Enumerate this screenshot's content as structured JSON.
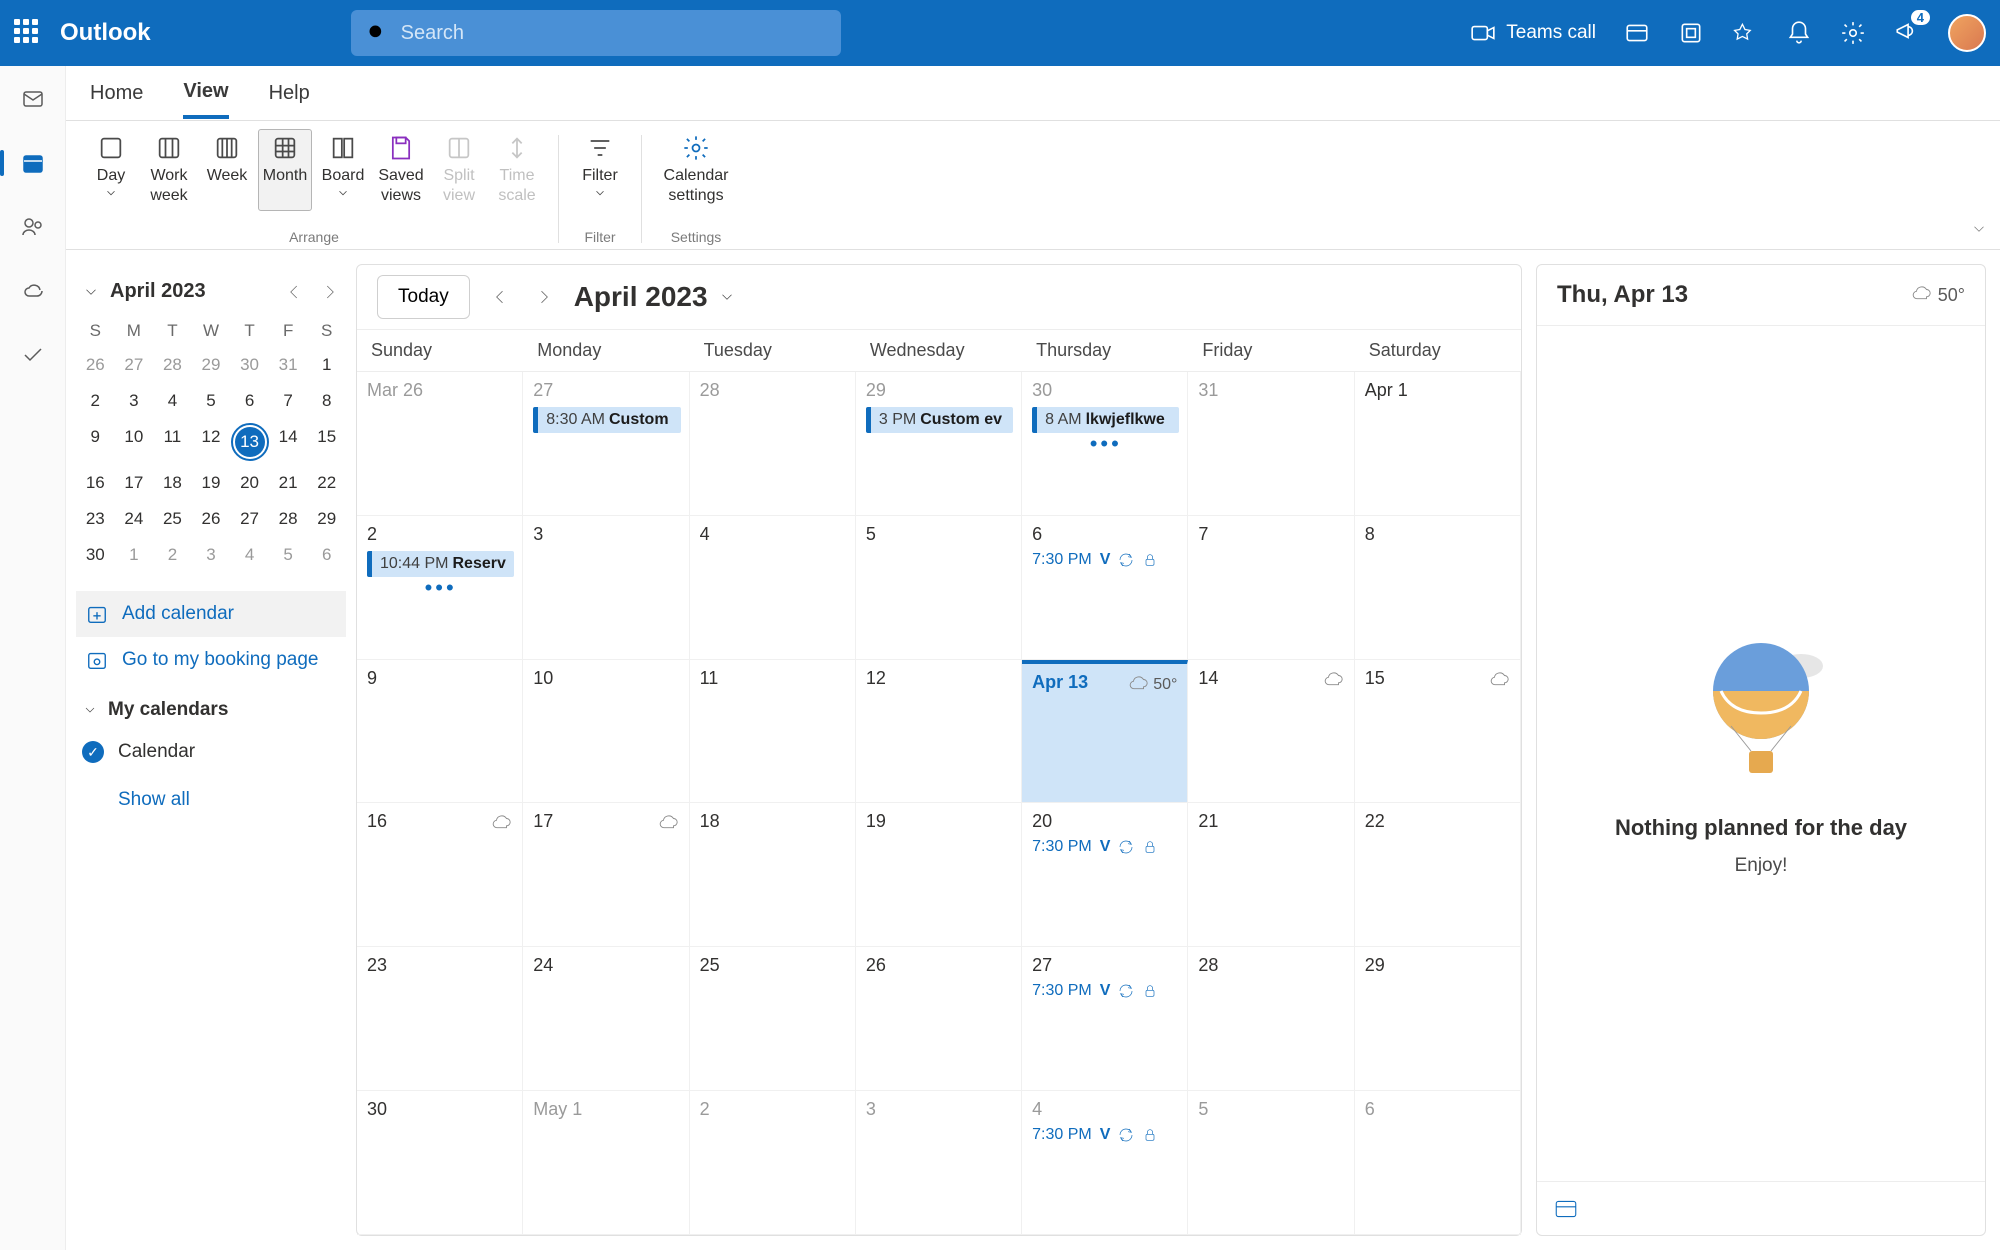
{
  "header": {
    "app_title": "Outlook",
    "search_placeholder": "Search",
    "teams_call": "Teams call",
    "notif_count": "4"
  },
  "tabs": {
    "home": "Home",
    "view": "View",
    "help": "Help",
    "active": "View"
  },
  "ribbon": {
    "day": "Day",
    "work_week": "Work week",
    "week": "Week",
    "month": "Month",
    "board": "Board",
    "saved_views": "Saved views",
    "split_view": "Split view",
    "time_scale": "Time scale",
    "filter": "Filter",
    "calendar_settings": "Calendar settings",
    "group_arrange": "Arrange",
    "group_filter": "Filter",
    "group_settings": "Settings"
  },
  "mini_cal": {
    "title": "April 2023",
    "dow": [
      "S",
      "M",
      "T",
      "W",
      "T",
      "F",
      "S"
    ],
    "days": [
      {
        "n": "26",
        "dim": true
      },
      {
        "n": "27",
        "dim": true
      },
      {
        "n": "28",
        "dim": true
      },
      {
        "n": "29",
        "dim": true
      },
      {
        "n": "30",
        "dim": true
      },
      {
        "n": "31",
        "dim": true
      },
      {
        "n": "1"
      },
      {
        "n": "2"
      },
      {
        "n": "3"
      },
      {
        "n": "4"
      },
      {
        "n": "5"
      },
      {
        "n": "6"
      },
      {
        "n": "7"
      },
      {
        "n": "8"
      },
      {
        "n": "9"
      },
      {
        "n": "10"
      },
      {
        "n": "11"
      },
      {
        "n": "12"
      },
      {
        "n": "13",
        "today": true
      },
      {
        "n": "14"
      },
      {
        "n": "15"
      },
      {
        "n": "16"
      },
      {
        "n": "17"
      },
      {
        "n": "18"
      },
      {
        "n": "19"
      },
      {
        "n": "20"
      },
      {
        "n": "21"
      },
      {
        "n": "22"
      },
      {
        "n": "23"
      },
      {
        "n": "24"
      },
      {
        "n": "25"
      },
      {
        "n": "26"
      },
      {
        "n": "27"
      },
      {
        "n": "28"
      },
      {
        "n": "29"
      },
      {
        "n": "30"
      },
      {
        "n": "1",
        "dim": true
      },
      {
        "n": "2",
        "dim": true
      },
      {
        "n": "3",
        "dim": true
      },
      {
        "n": "4",
        "dim": true
      },
      {
        "n": "5",
        "dim": true
      },
      {
        "n": "6",
        "dim": true
      }
    ]
  },
  "sidebar": {
    "add_calendar": "Add calendar",
    "booking_page": "Go to my booking page",
    "my_calendars": "My calendars",
    "calendar_item": "Calendar",
    "show_all": "Show all"
  },
  "calendar": {
    "today_btn": "Today",
    "month_title": "April 2023",
    "dow": [
      "Sunday",
      "Monday",
      "Tuesday",
      "Wednesday",
      "Thursday",
      "Friday",
      "Saturday"
    ],
    "cells": [
      {
        "date": "Mar 26",
        "dim": true
      },
      {
        "date": "27",
        "dim": true,
        "events": [
          {
            "time": "8:30 AM",
            "title": "Custom"
          }
        ]
      },
      {
        "date": "28",
        "dim": true
      },
      {
        "date": "29",
        "dim": true,
        "events": [
          {
            "time": "3 PM",
            "title": "Custom ev"
          }
        ]
      },
      {
        "date": "30",
        "dim": true,
        "events": [
          {
            "time": "8 AM",
            "title": "lkwjeflkwe"
          }
        ],
        "more": true
      },
      {
        "date": "31",
        "dim": true
      },
      {
        "date": "Apr 1"
      },
      {
        "date": "2",
        "events": [
          {
            "time": "10:44 PM",
            "title": "Reserv"
          }
        ],
        "more": true
      },
      {
        "date": "3"
      },
      {
        "date": "4"
      },
      {
        "date": "5"
      },
      {
        "date": "6",
        "link_events": [
          {
            "time": "7:30 PM",
            "title": "V",
            "recur": true,
            "priv": true
          }
        ]
      },
      {
        "date": "7"
      },
      {
        "date": "8"
      },
      {
        "date": "9"
      },
      {
        "date": "10"
      },
      {
        "date": "11"
      },
      {
        "date": "12"
      },
      {
        "date": "Apr 13",
        "today": true,
        "weather": "50°"
      },
      {
        "date": "14",
        "weather_icon": true
      },
      {
        "date": "15",
        "weather_icon": true
      },
      {
        "date": "16",
        "weather_icon": true
      },
      {
        "date": "17",
        "weather_icon": true
      },
      {
        "date": "18"
      },
      {
        "date": "19"
      },
      {
        "date": "20",
        "link_events": [
          {
            "time": "7:30 PM",
            "title": "V",
            "recur": true,
            "priv": true
          }
        ]
      },
      {
        "date": "21"
      },
      {
        "date": "22"
      },
      {
        "date": "23"
      },
      {
        "date": "24"
      },
      {
        "date": "25"
      },
      {
        "date": "26"
      },
      {
        "date": "27",
        "link_events": [
          {
            "time": "7:30 PM",
            "title": "V",
            "recur": true,
            "priv": true
          }
        ]
      },
      {
        "date": "28"
      },
      {
        "date": "29"
      },
      {
        "date": "30"
      },
      {
        "date": "May 1",
        "dim": true
      },
      {
        "date": "2",
        "dim": true
      },
      {
        "date": "3",
        "dim": true
      },
      {
        "date": "4",
        "dim": true,
        "link_events": [
          {
            "time": "7:30 PM",
            "title": "V",
            "recur": true,
            "priv": true
          }
        ]
      },
      {
        "date": "5",
        "dim": true
      },
      {
        "date": "6",
        "dim": true
      }
    ]
  },
  "agenda": {
    "title": "Thu, Apr 13",
    "temp": "50°",
    "empty_title": "Nothing planned for the day",
    "empty_sub": "Enjoy!"
  }
}
